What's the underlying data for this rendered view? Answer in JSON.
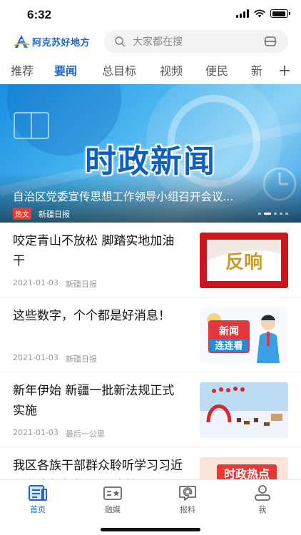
{
  "status_bar": {
    "time": "6:32",
    "battery_level": 0.9
  },
  "header": {
    "logo_text": "阿克苏好地方",
    "search_placeholder": "大家都在搜",
    "icons": [
      "logo-mark-icon",
      "search-icon",
      "scan-icon"
    ]
  },
  "tabs": {
    "items": [
      "推荐",
      "要闻",
      "总目标",
      "视频",
      "便民",
      "新"
    ],
    "active": "要闻",
    "add_icon": "plus-icon"
  },
  "banner": {
    "image_title": "时政新闻",
    "headline": "自治区党委宣传思想工作领导小组召开会议...",
    "badge": "热文",
    "source": "新疆日报",
    "slide_count": 5,
    "active_slide": 1
  },
  "news": [
    {
      "title": "咬定青山不放松 脚踏实地加油干",
      "date": "2021-01-03",
      "source": "新疆日报",
      "thumb_text": "反响",
      "thumb": "response-thumbnail"
    },
    {
      "title": "这些数字，个个都是好消息！",
      "date": "2021-01-03",
      "source": "新疆日报",
      "thumb_text": "新闻\n连连看",
      "thumb": "news-cartoon-thumbnail"
    },
    {
      "title": "新年伊始 新疆一批新法规正式实施",
      "date": "2021-01-03",
      "source": "最后一公里",
      "thumb": "snow-festival-thumbnail"
    },
    {
      "title": "我区各族干部群众聆听学习习近平主席新年贺词 一直情",
      "thumb_text": "时政热点",
      "thumb": "hot-topic-thumbnail"
    }
  ],
  "bottom_nav": {
    "items": [
      {
        "label": "首页",
        "icon": "home-news-icon",
        "active": true
      },
      {
        "label": "融媒",
        "icon": "media-icon",
        "active": false
      },
      {
        "label": "报料",
        "icon": "report-icon",
        "active": false
      },
      {
        "label": "我",
        "icon": "profile-icon",
        "active": false
      }
    ]
  },
  "colors": {
    "accent": "#1e64c8",
    "badge": "#e23b2f",
    "thumb_red": "#c8161d"
  }
}
